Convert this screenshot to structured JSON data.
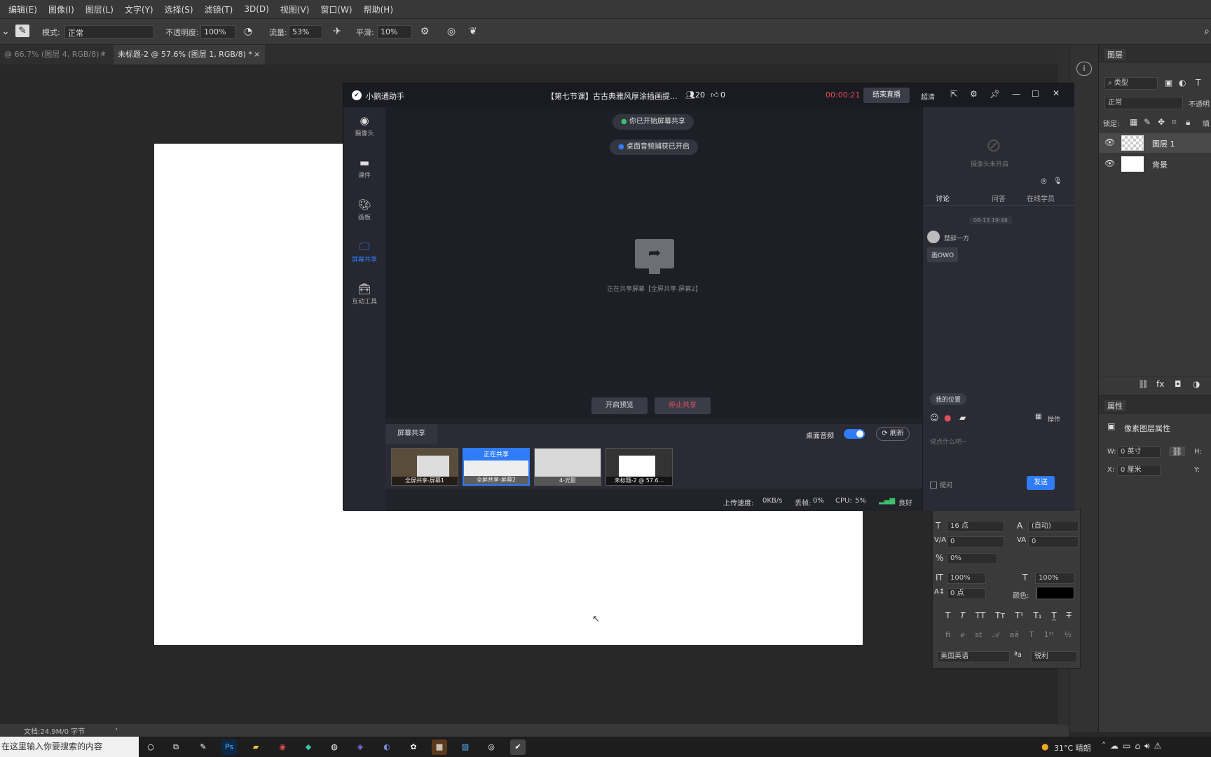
{
  "menubar": {
    "items": [
      "编辑(E)",
      "图像(I)",
      "图层(L)",
      "文字(Y)",
      "选择(S)",
      "滤镜(T)",
      "3D(D)",
      "视图(V)",
      "窗口(W)",
      "帮助(H)"
    ]
  },
  "options": {
    "mode_label": "模式:",
    "mode_value": "正常",
    "opacity_label": "不透明度:",
    "opacity_value": "100%",
    "flow_label": "流量:",
    "flow_value": "53%",
    "smooth_label": "平滑:",
    "smooth_value": "10%"
  },
  "tabs": [
    {
      "label": "@ 66.7% (图层 4, RGB/8) *"
    },
    {
      "label": "未标题-2 @ 57.6% (图层 1, RGB/8) *"
    }
  ],
  "statusbar": {
    "doc": "文档:24.9M/0 字节"
  },
  "layers_panel": {
    "title": "图层",
    "filter": "类型",
    "blend": "正常",
    "opacity": "不透明",
    "lock_label": "锁定:",
    "fill": "填",
    "layers": [
      {
        "name": "图层 1"
      },
      {
        "name": "背景"
      }
    ]
  },
  "properties_panel": {
    "title": "属性",
    "subtitle": "像素图层属性",
    "w_label": "W:",
    "w_value": "0 英寸",
    "h_label": "H:",
    "x_label": "X:",
    "x_value": "0 厘米",
    "y_label": "Y:"
  },
  "character_panel": {
    "size": "16 点",
    "leading": "(自动)",
    "kerning": "0",
    "tracking": "0",
    "scale_pct": "0%",
    "vscale": "100%",
    "hscale": "100%",
    "baseline": "0 点",
    "color_label": "颜色:",
    "color": "#000000",
    "language": "美国英语",
    "aa": "锐利"
  },
  "app": {
    "name": "小鹅通助手",
    "course_title": "【第七节课】古古典雅风厚涂插画提...",
    "viewers": "20",
    "likes": "0",
    "timer": "00:00:21",
    "end_button": "结束直播",
    "quality": "超清",
    "nav": [
      {
        "label": "摄像头"
      },
      {
        "label": "课件"
      },
      {
        "label": "画板"
      },
      {
        "label": "屏幕共享"
      },
      {
        "label": "互动工具"
      }
    ],
    "toast1": "你已开始屏幕共享",
    "toast2": "桌面音频捕获已开启",
    "sharing_text": "正在共享屏幕【全屏共享-屏幕2】",
    "preview_button": "开启预览",
    "stop_button": "停止共享",
    "share_tab": "屏幕共享",
    "desktop_audio": "桌面音频",
    "refresh": "刷新",
    "thumbs": [
      {
        "caption": "全屏共享-屏幕1"
      },
      {
        "caption": "全屏共享-屏幕2",
        "badge": "正在共享"
      },
      {
        "caption": "4-光影"
      },
      {
        "caption": "未标题-2 @ 57.6..."
      }
    ],
    "upload_label": "上传速度:",
    "upload": "0KB/s",
    "drop_label": "丢帧:",
    "drop": "0%",
    "cpu_label": "CPU:",
    "cpu": "5%",
    "network": "良好",
    "chat": {
      "camera_off": "摄像头未开启",
      "tabs": [
        "讨论",
        "问答",
        "在线学员"
      ],
      "timestamp": "08-13 19:48",
      "user": "楚辞一方",
      "message": "画OWO",
      "location": "我的位置",
      "ops": "操作",
      "placeholder": "说点什么吧~",
      "ask": "提问",
      "send": "发送"
    }
  },
  "taskbar": {
    "search": "在这里输入你要搜索的内容",
    "weather": "31°C 晴朗"
  },
  "colors": {
    "accent": "#1a73e8",
    "stop": "#e0505a",
    "timer": "#e34d4d"
  }
}
